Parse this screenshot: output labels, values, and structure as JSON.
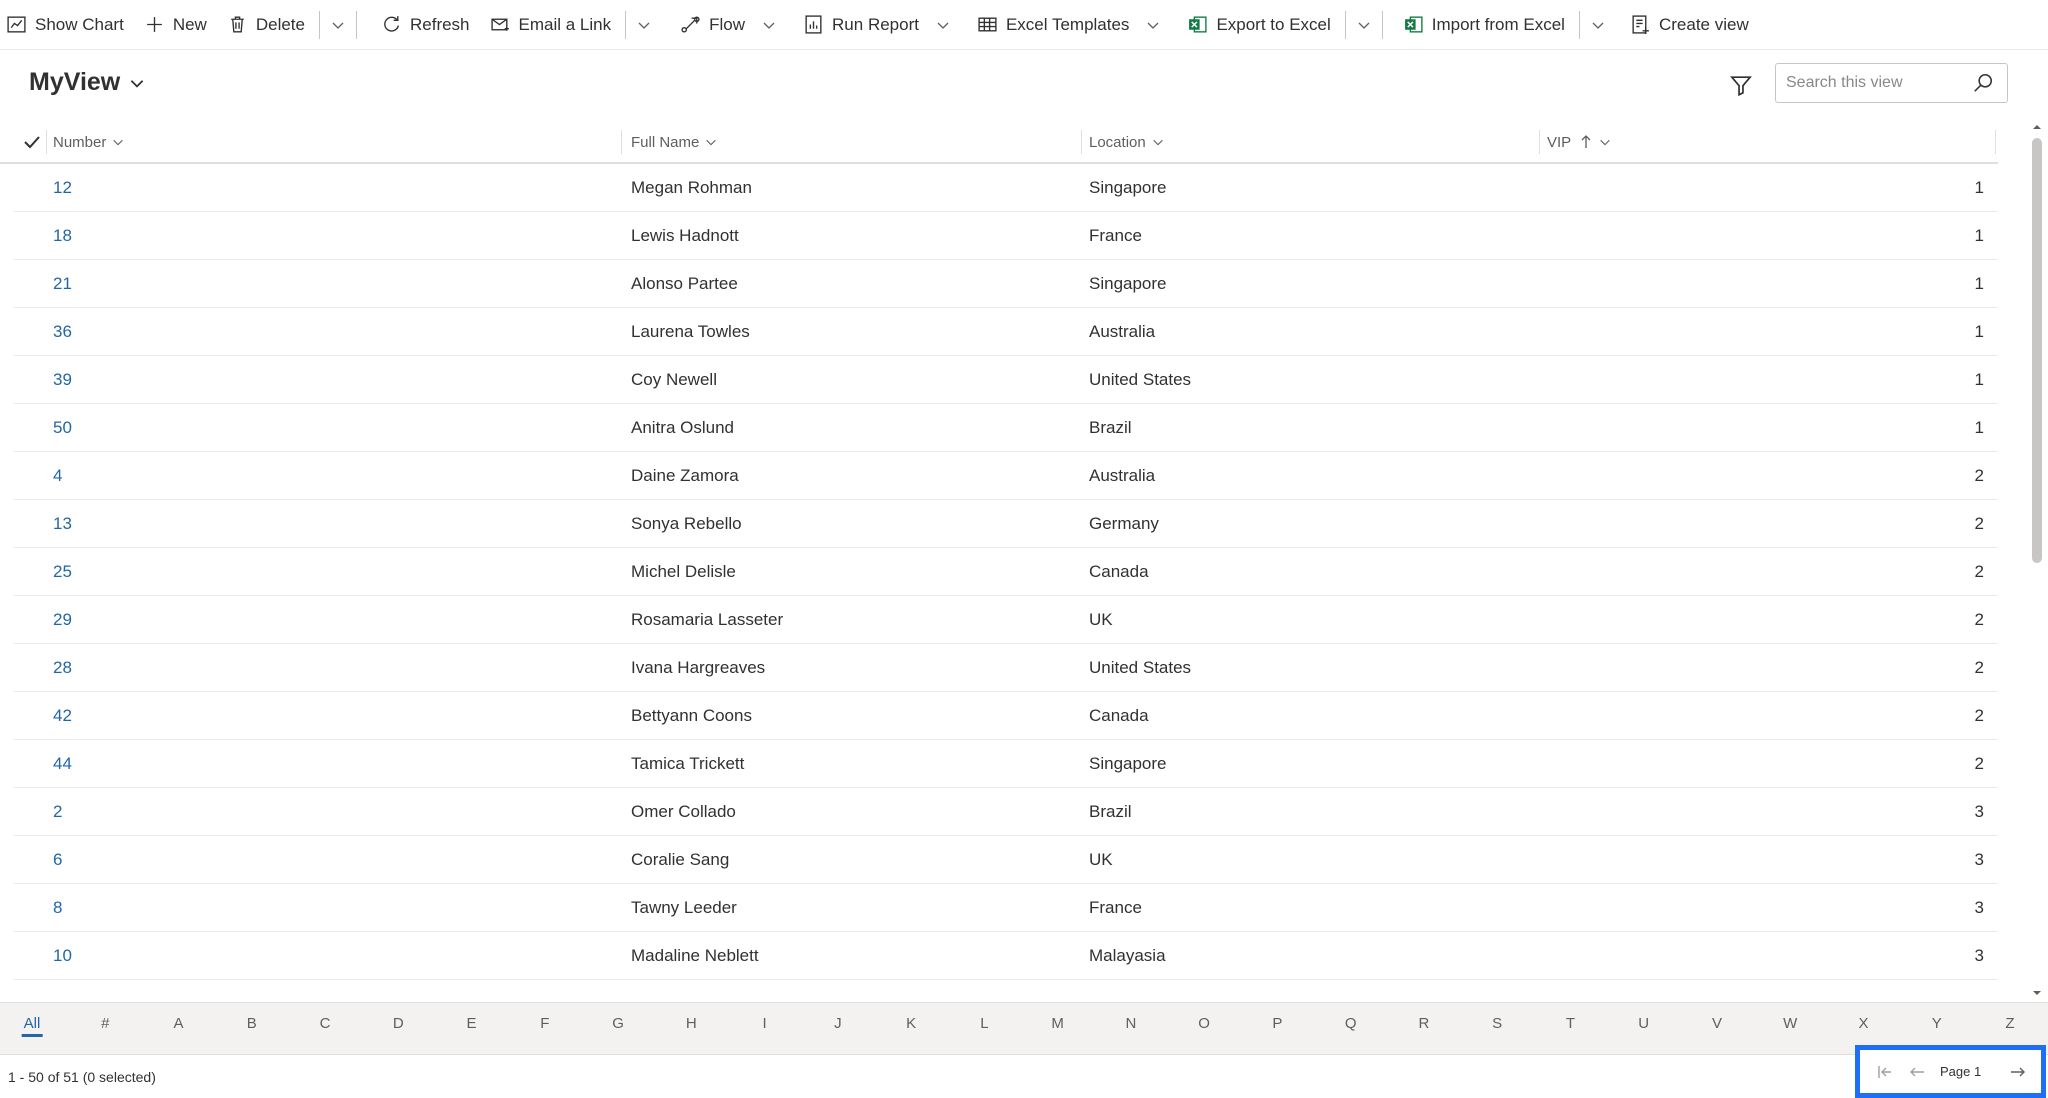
{
  "toolbar": {
    "show_chart": "Show Chart",
    "new": "New",
    "delete": "Delete",
    "refresh": "Refresh",
    "email_link": "Email a Link",
    "flow": "Flow",
    "run_report": "Run Report",
    "excel_templates": "Excel Templates",
    "export_excel": "Export to Excel",
    "import_excel": "Import from Excel",
    "create_view": "Create view"
  },
  "view": {
    "title": "MyView",
    "search_placeholder": "Search this view"
  },
  "columns": {
    "number": "Number",
    "full_name": "Full Name",
    "location": "Location",
    "vip": "VIP"
  },
  "rows": [
    {
      "number": "12",
      "name": "Megan Rohman",
      "location": "Singapore",
      "vip": "1"
    },
    {
      "number": "18",
      "name": "Lewis Hadnott",
      "location": "France",
      "vip": "1"
    },
    {
      "number": "21",
      "name": "Alonso Partee",
      "location": "Singapore",
      "vip": "1"
    },
    {
      "number": "36",
      "name": "Laurena Towles",
      "location": "Australia",
      "vip": "1"
    },
    {
      "number": "39",
      "name": "Coy Newell",
      "location": "United States",
      "vip": "1"
    },
    {
      "number": "50",
      "name": "Anitra Oslund",
      "location": "Brazil",
      "vip": "1"
    },
    {
      "number": "4",
      "name": "Daine Zamora",
      "location": "Australia",
      "vip": "2"
    },
    {
      "number": "13",
      "name": "Sonya Rebello",
      "location": "Germany",
      "vip": "2"
    },
    {
      "number": "25",
      "name": "Michel Delisle",
      "location": "Canada",
      "vip": "2"
    },
    {
      "number": "29",
      "name": "Rosamaria Lasseter",
      "location": "UK",
      "vip": "2"
    },
    {
      "number": "28",
      "name": "Ivana Hargreaves",
      "location": "United States",
      "vip": "2"
    },
    {
      "number": "42",
      "name": "Bettyann Coons",
      "location": "Canada",
      "vip": "2"
    },
    {
      "number": "44",
      "name": "Tamica Trickett",
      "location": "Singapore",
      "vip": "2"
    },
    {
      "number": "2",
      "name": "Omer Collado",
      "location": "Brazil",
      "vip": "3"
    },
    {
      "number": "6",
      "name": "Coralie Sang",
      "location": "UK",
      "vip": "3"
    },
    {
      "number": "8",
      "name": "Tawny Leeder",
      "location": "France",
      "vip": "3"
    },
    {
      "number": "10",
      "name": "Madaline Neblett",
      "location": "Malayasia",
      "vip": "3"
    }
  ],
  "jump_letters": [
    "All",
    "#",
    "A",
    "B",
    "C",
    "D",
    "E",
    "F",
    "G",
    "H",
    "I",
    "J",
    "K",
    "L",
    "M",
    "N",
    "O",
    "P",
    "Q",
    "R",
    "S",
    "T",
    "U",
    "V",
    "W",
    "X",
    "Y",
    "Z"
  ],
  "status": "1 - 50 of 51 (0 selected)",
  "pager": {
    "label": "Page 1"
  },
  "colors": {
    "link": "#2266aa",
    "highlight": "#1e6ff5",
    "excel_green": "#107c41"
  }
}
